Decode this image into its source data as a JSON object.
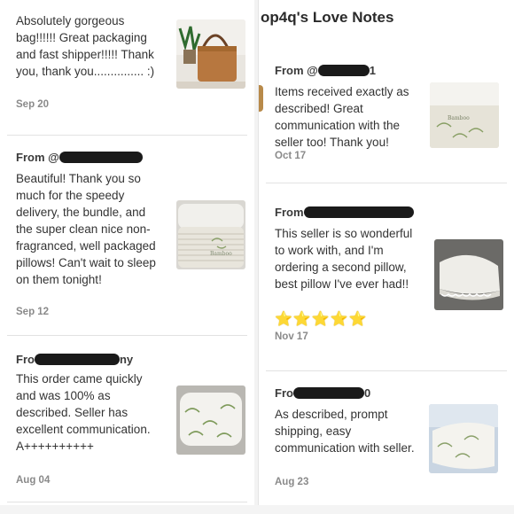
{
  "header": {
    "title": "op4q's Love Notes"
  },
  "left": [
    {
      "from_prefix": "",
      "message": "Absolutely gorgeous bag!!!!!! Great packaging and fast shipper!!!!! Thank you, thank you............... :)",
      "date": "Sep 20",
      "thumb_icon": "handbag-photo"
    },
    {
      "from_prefix": "From @",
      "message": "Beautiful! Thank you so much for the speedy delivery, the bundle, and the super clean nice non-fragranced, well packaged pillows! Can't wait to sleep on them tonight!",
      "date": "Sep 12",
      "thumb_icon": "pillow-photo"
    },
    {
      "from_prefix": "Fro",
      "from_suffix": "ny",
      "message": "This order came quickly and was 100% as described. Seller has excellent communication. A++++++++++",
      "date": "Aug 04",
      "thumb_icon": "pillow-photo"
    }
  ],
  "right": [
    {
      "from_prefix": "From @",
      "from_suffix": "1",
      "message": "Items received exactly as described! Great communication with the seller too! Thank you!",
      "date": "Oct 17",
      "thumb_icon": "pillow-photo"
    },
    {
      "from_prefix": "From",
      "message": "This seller is so wonderful to work with, and I'm ordering a second pillow, best pillow I've ever had!!",
      "stars": "⭐⭐⭐⭐⭐",
      "date": "Nov 17",
      "thumb_icon": "pillow-photo"
    },
    {
      "from_prefix": "Fro",
      "from_suffix": "0",
      "message": "As described, prompt shipping, easy communication with seller.",
      "date": "Aug 23",
      "thumb_icon": "pillow-photo"
    }
  ],
  "colors": {
    "text": "#333333",
    "date": "#8a8a8a",
    "divider": "#e2e2e2",
    "star": "#f5c518"
  }
}
